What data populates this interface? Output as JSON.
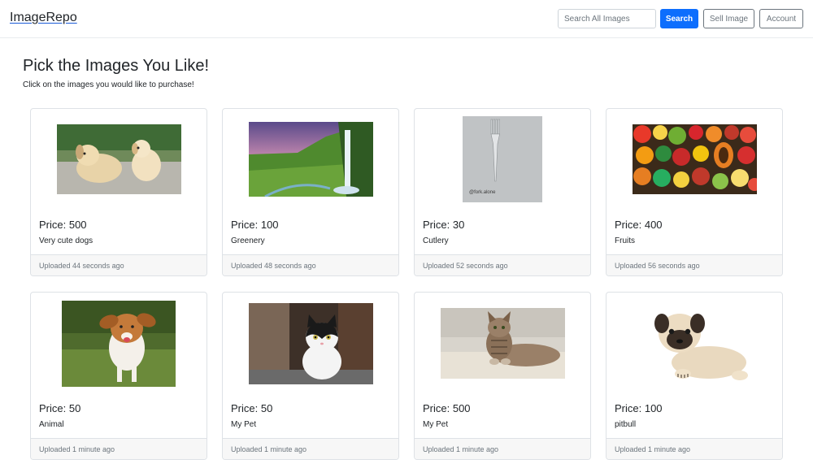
{
  "navbar": {
    "brand": "ImageRepo",
    "search_placeholder": "Search All Images",
    "search_button": "Search",
    "sell_button": "Sell Image",
    "account_button": "Account"
  },
  "main": {
    "title": "Pick the Images You Like!",
    "subtitle": "Click on the images you would like to purchase!"
  },
  "cards": [
    {
      "price": "Price: 500",
      "description": "Very cute dogs",
      "uploaded": "Uploaded 44 seconds ago",
      "image": "two-puppies-photo"
    },
    {
      "price": "Price: 100",
      "description": "Greenery",
      "uploaded": "Uploaded 48 seconds ago",
      "image": "waterfall-landscape-photo"
    },
    {
      "price": "Price: 30",
      "description": "Cutlery",
      "uploaded": "Uploaded 52 seconds ago",
      "image": "fork-photo",
      "image_caption": "@fork.alone"
    },
    {
      "price": "Price: 400",
      "description": "Fruits",
      "uploaded": "Uploaded 56 seconds ago",
      "image": "fruits-vegetables-photo"
    },
    {
      "price": "Price: 50",
      "description": "Animal",
      "uploaded": "Uploaded 1 minute ago",
      "image": "running-beagle-photo"
    },
    {
      "price": "Price: 50",
      "description": "My Pet",
      "uploaded": "Uploaded 1 minute ago",
      "image": "kitten-photo"
    },
    {
      "price": "Price: 500",
      "description": "My Pet",
      "uploaded": "Uploaded 1 minute ago",
      "image": "tabby-cat-photo"
    },
    {
      "price": "Price: 100",
      "description": "pitbull",
      "uploaded": "Uploaded 1 minute ago",
      "image": "pug-puppy-photo"
    }
  ]
}
